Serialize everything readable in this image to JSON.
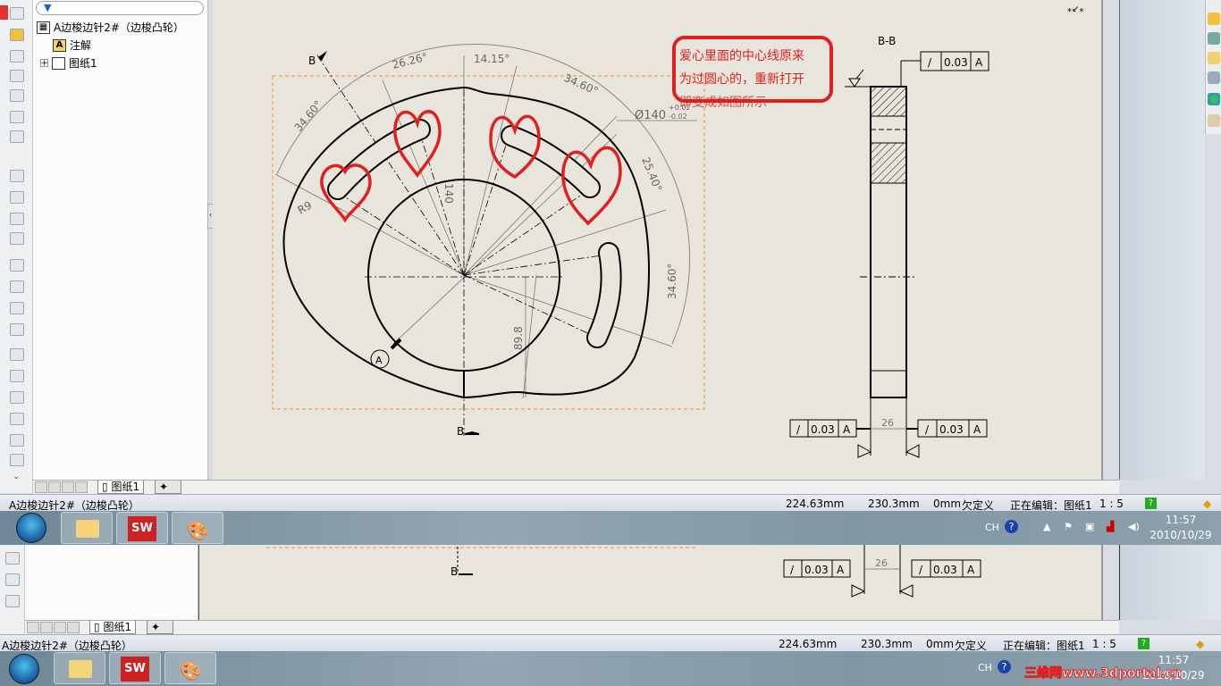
{
  "window": {
    "title": "A边梭边针2#（边梭凸轮）"
  },
  "tree": {
    "filter_icon": "filter-icon",
    "root": "A边梭边针2#（边梭凸轮）",
    "items": [
      {
        "label": "注解",
        "icon": "annotation-folder-icon"
      },
      {
        "label": "图纸1",
        "icon": "sheet-icon"
      }
    ]
  },
  "sheet_tabs": {
    "active": "图纸1",
    "add_icon": "add-sheet-icon"
  },
  "status": {
    "x": "224.63mm",
    "y": "230.3mm",
    "z": "0mm",
    "state": "欠定义",
    "editing": "正在编辑：图纸1",
    "scale": "1 : 5",
    "help_icon": "help-icon",
    "tag_icon": "tag-icon"
  },
  "taskbar": {
    "apps": [
      "windows-explorer",
      "solidworks",
      "paint"
    ],
    "sw_label": "SW",
    "lang": "CH",
    "time": "11:57",
    "date": "2010/10/29"
  },
  "note": {
    "lines": [
      "爱心里面的中心线原来",
      "为过圆心的，重新打开",
      "即变成如图所示"
    ],
    "color": "#e02020"
  },
  "drawing": {
    "dims": {
      "a1": "26.26°",
      "a2": "14.15°",
      "a3": "34.60°",
      "a4": "34.60°",
      "a5": "25.40°",
      "a6": "34.60°",
      "dia": "Ø140",
      "tol_plus": "+0.02",
      "tol_minus": "-0.02",
      "r": "R9",
      "h": "140",
      "v": "89.8",
      "datum": "A",
      "sec": "B",
      "section_title": "B-B",
      "width": "26"
    },
    "tolerance": {
      "symbol": "/",
      "value": "0.03",
      "datum": "A"
    }
  },
  "watermark": "三维网www.3dportal.cn"
}
